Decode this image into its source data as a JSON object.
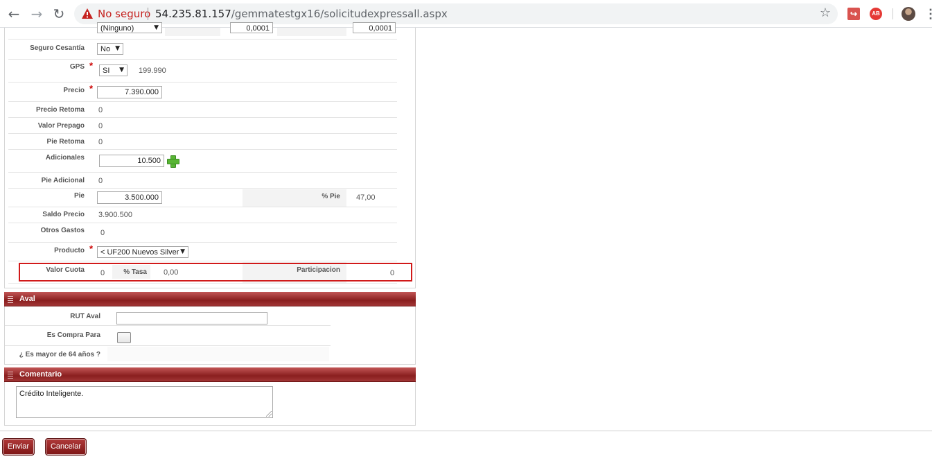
{
  "browser": {
    "back_icon": "arrow-left",
    "forward_icon": "arrow-right",
    "reload_icon": "reload",
    "not_secure_label": "No seguro",
    "url_host": "54.235.81.157",
    "url_path": "/gemmatestgx16/solicitudexpressall.aspx",
    "accent_warning": "#c5221f"
  },
  "form": {
    "top_partial": {
      "select": "(Ninguno)",
      "val1": "0,0001",
      "val2": "0,0001"
    },
    "seguro_cesantia": {
      "label": "Seguro Cesantía",
      "value": "No"
    },
    "gps": {
      "label": "GPS",
      "value": "SI",
      "amount": "199.990"
    },
    "precio": {
      "label": "Precio",
      "value": "7.390.000"
    },
    "precio_retoma": {
      "label": "Precio Retoma",
      "value": "0"
    },
    "valor_prepago": {
      "label": "Valor Prepago",
      "value": "0"
    },
    "pie_retoma": {
      "label": "Pie Retoma",
      "value": "0"
    },
    "adicionales": {
      "label": "Adicionales",
      "value": "10.500"
    },
    "pie_adicional": {
      "label": "Pie Adicional",
      "value": "0"
    },
    "pie": {
      "label": "Pie",
      "value": "3.500.000",
      "pct_label": "% Pie",
      "pct_value": "47,00"
    },
    "saldo_precio": {
      "label": "Saldo Precio",
      "value": "3.900.500"
    },
    "otros_gastos": {
      "label": "Otros Gastos",
      "value": "0"
    },
    "producto": {
      "label": "Producto",
      "value": "< UF200 Nuevos Silver"
    },
    "valor_cuota": {
      "label": "Valor Cuota",
      "value": "0",
      "tasa_label": "% Tasa",
      "tasa_value": "0,00",
      "participacion_label": "Participacion",
      "participacion_value": "0"
    },
    "required_mark": "*"
  },
  "aval": {
    "title": "Aval",
    "rut_label": "RUT Aval",
    "rut_value": "",
    "compra_label": "Es Compra Para",
    "mayor_label": "¿ Es mayor de 64 años ?"
  },
  "comentario": {
    "title": "Comentario",
    "text": "Crédito Inteligente."
  },
  "actions": {
    "enviar": "Enviar",
    "cancelar": "Cancelar"
  },
  "colors": {
    "section_header": "#8a1f1f",
    "button": "#8e2222",
    "highlight": "#d11919"
  }
}
